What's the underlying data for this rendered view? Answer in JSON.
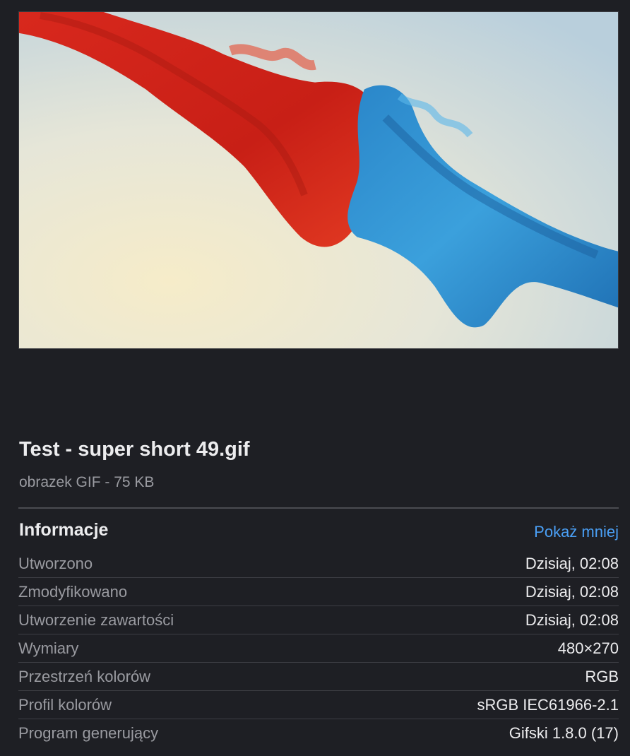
{
  "file": {
    "name": "Test - super short 49.gif",
    "subtitle": "obrazek GIF - 75 KB"
  },
  "info": {
    "title": "Informacje",
    "toggle_label": "Pokaż mniej",
    "rows": [
      {
        "label": "Utworzono",
        "value": "Dzisiaj, 02:08"
      },
      {
        "label": "Zmodyfikowano",
        "value": "Dzisiaj, 02:08"
      },
      {
        "label": "Utworzenie zawartości",
        "value": "Dzisiaj, 02:08"
      },
      {
        "label": "Wymiary",
        "value": "480×270"
      },
      {
        "label": "Przestrzeń kolorów",
        "value": "RGB"
      },
      {
        "label": "Profil kolorów",
        "value": "sRGB IEC61966-2.1"
      },
      {
        "label": "Program generujący",
        "value": "Gifski 1.8.0 (17)"
      }
    ]
  },
  "colors": {
    "background": "#1e1f24",
    "link": "#4a9ff5",
    "label": "#9a9ba1",
    "value": "#ececee"
  }
}
